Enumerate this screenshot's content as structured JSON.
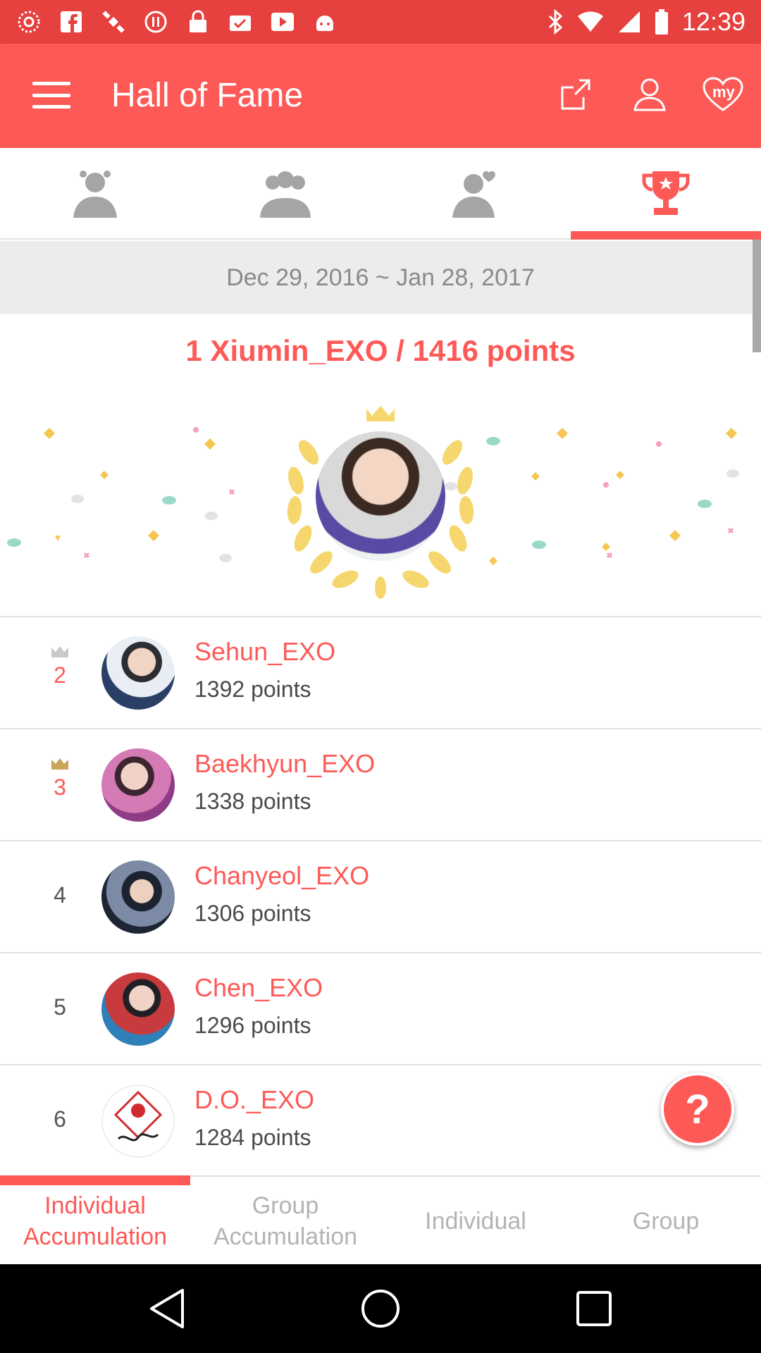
{
  "status_bar": {
    "time": "12:39",
    "left_icons": [
      "aperture-icon",
      "facebook-icon",
      "satellite-icon",
      "pause-icon",
      "lock-icon",
      "briefcase-check-icon",
      "play-icon",
      "android-icon"
    ],
    "right_icons": [
      "bluetooth-icon",
      "wifi-icon",
      "signal-icon",
      "battery-icon"
    ]
  },
  "app_bar": {
    "title": "Hall of Fame",
    "icons": [
      "share-icon",
      "profile-icon",
      "heart-my-icon"
    ],
    "heart_label": "my"
  },
  "category_tabs": [
    {
      "icon": "single-person-icon"
    },
    {
      "icon": "group-icon"
    },
    {
      "icon": "person-heart-icon"
    },
    {
      "icon": "trophy-icon",
      "active": true
    }
  ],
  "date_range": "Dec 29, 2016 ~ Jan 28, 2017",
  "winner": {
    "title": "1 Xiumin_EXO / 1416 points"
  },
  "rankings": [
    {
      "rank": "2",
      "crown": true,
      "name": "Sehun_EXO",
      "points": "1392 points"
    },
    {
      "rank": "3",
      "crown": true,
      "name": "Baekhyun_EXO",
      "points": "1338 points"
    },
    {
      "rank": "4",
      "crown": false,
      "name": "Chanyeol_EXO",
      "points": "1306 points"
    },
    {
      "rank": "5",
      "crown": false,
      "name": "Chen_EXO",
      "points": "1296 points"
    },
    {
      "rank": "6",
      "crown": false,
      "name": "D.O._EXO",
      "points": "1284 points"
    }
  ],
  "help_button": "?",
  "bottom_tabs": {
    "individual_accumulation_1": "Individual",
    "individual_accumulation_2": "Accumulation",
    "group_accumulation_1": "Group",
    "group_accumulation_2": "Accumulation",
    "individual": "Individual",
    "group": "Group"
  },
  "colors": {
    "accent": "#fd5a57",
    "status_bar": "#e6413e",
    "gold": "#f5d76e"
  }
}
